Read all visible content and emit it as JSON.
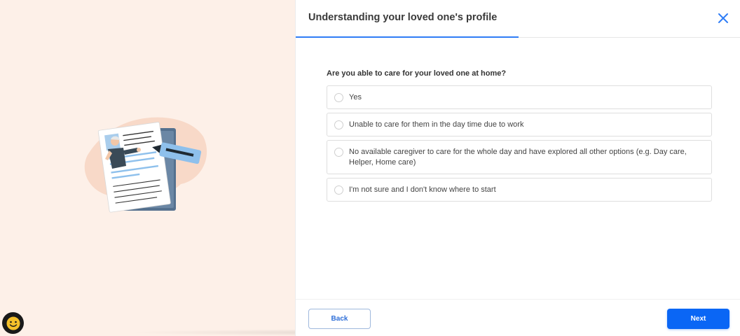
{
  "header": {
    "title": "Understanding your loved one's profile",
    "progress_fraction": 0.5
  },
  "question": {
    "text": "Are you able to care for your loved one at home?",
    "options": [
      {
        "label": "Yes",
        "selected": false
      },
      {
        "label": "Unable to care for them in the day time due to work",
        "selected": false
      },
      {
        "label": "No available caregiver to care for the whole day and have explored all other options (e.g. Day care, Helper, Home care)",
        "selected": false
      },
      {
        "label": "I'm not sure and I don't know where to start",
        "selected": false
      }
    ]
  },
  "footer": {
    "back_label": "Back",
    "next_label": "Next"
  },
  "icons": {
    "close": "close-icon",
    "help": "smiley-icon",
    "illustration": "profile-document-illustration"
  },
  "colors": {
    "accent": "#0a66f5",
    "left_background": "#fdf0e8",
    "close_icon": "#2f7df6"
  }
}
